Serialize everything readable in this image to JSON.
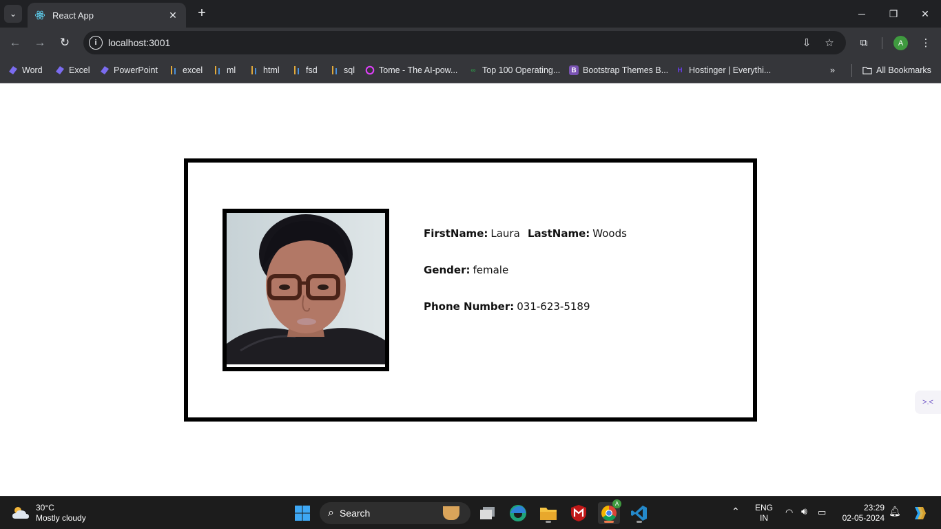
{
  "browser": {
    "tab_title": "React App",
    "url": "localhost:3001",
    "profile_initial": "A",
    "bookmarks": [
      {
        "label": "Word",
        "icon": "copilot-icon"
      },
      {
        "label": "Excel",
        "icon": "copilot-icon"
      },
      {
        "label": "PowerPoint",
        "icon": "copilot-icon"
      },
      {
        "label": "excel",
        "icon": "bars-icon"
      },
      {
        "label": "ml",
        "icon": "bars-icon"
      },
      {
        "label": "html",
        "icon": "bars-icon"
      },
      {
        "label": "fsd",
        "icon": "bars-icon"
      },
      {
        "label": "sql",
        "icon": "bars-icon"
      },
      {
        "label": "Tome - The AI-pow...",
        "icon": "tome-icon"
      },
      {
        "label": "Top 100 Operating...",
        "icon": "gfg-icon"
      },
      {
        "label": "Bootstrap Themes B...",
        "icon": "bootstrap-icon"
      },
      {
        "label": "Hostinger | Everythi...",
        "icon": "hostinger-icon"
      }
    ],
    "all_bookmarks_label": "All Bookmarks"
  },
  "profile_card": {
    "fields": [
      {
        "label": "FirstName:",
        "value": "Laura"
      },
      {
        "label": "LastName:",
        "value": "Woods"
      },
      {
        "label": "Gender:",
        "value": "female"
      },
      {
        "label": "Phone Number:",
        "value": "031-623-5189"
      }
    ]
  },
  "taskbar": {
    "weather_temp": "30°C",
    "weather_desc": "Mostly cloudy",
    "search_label": "Search",
    "language": "ENG",
    "region": "IN",
    "time": "23:29",
    "date": "02-05-2024"
  },
  "colors": {
    "chrome_dark": "#202124",
    "chrome_toolbar": "#35363a",
    "card_border": "#000000",
    "taskbar": "#1c1c1c"
  }
}
